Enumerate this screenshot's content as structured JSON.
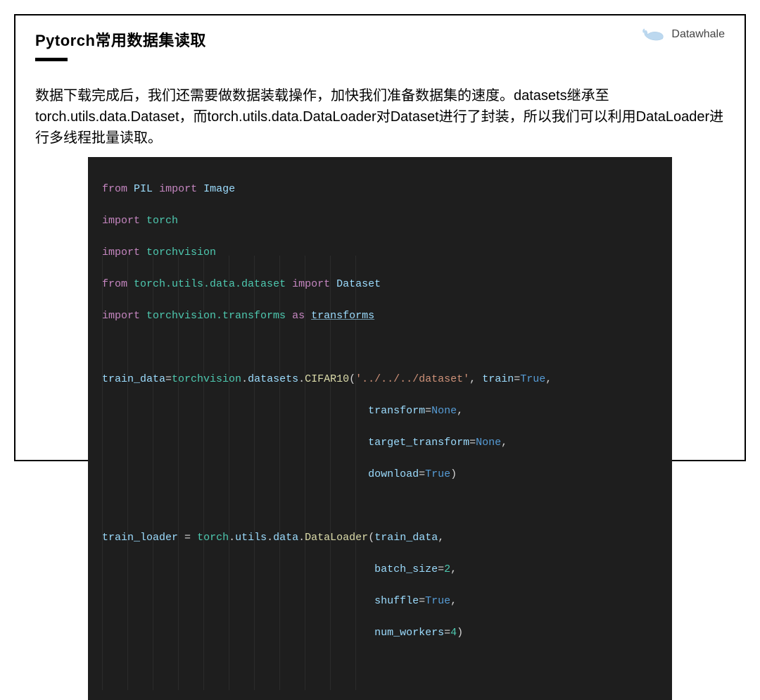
{
  "brand": "Datawhale",
  "title": "Pytorch常用数据集读取",
  "paragraph": "数据下载完成后，我们还需要做数据装载操作，加快我们准备数据集的速度。datasets继承至torch.utils.data.Dataset，而torch.utils.data.DataLoader对Dataset进行了封装，所以我们可以利用DataLoader进行多线程批量读取。",
  "code": {
    "kw_from": "from",
    "kw_import": "import",
    "kw_as": "as",
    "pil": "PIL",
    "image": "Image",
    "torch": "torch",
    "torchvision": "torchvision",
    "torch_utils_data_dataset": "torch.utils.data.dataset",
    "dataset_cls": "Dataset",
    "torchvision_transforms": "torchvision.transforms",
    "transforms": "transforms",
    "train_data": "train_data",
    "datasets": "datasets",
    "cifar10": "CIFAR10",
    "path": "'../../../dataset'",
    "train": "train",
    "transform": "transform",
    "target_transform": "target_transform",
    "download": "download",
    "true": "True",
    "none": "None",
    "train_loader": "train_loader",
    "utils": "utils",
    "data_mod": "data",
    "dataloader": "DataLoader",
    "batch_size": "batch_size",
    "batch_size_val": "2",
    "shuffle": "shuffle",
    "num_workers": "num_workers",
    "num_workers_val": "4"
  }
}
